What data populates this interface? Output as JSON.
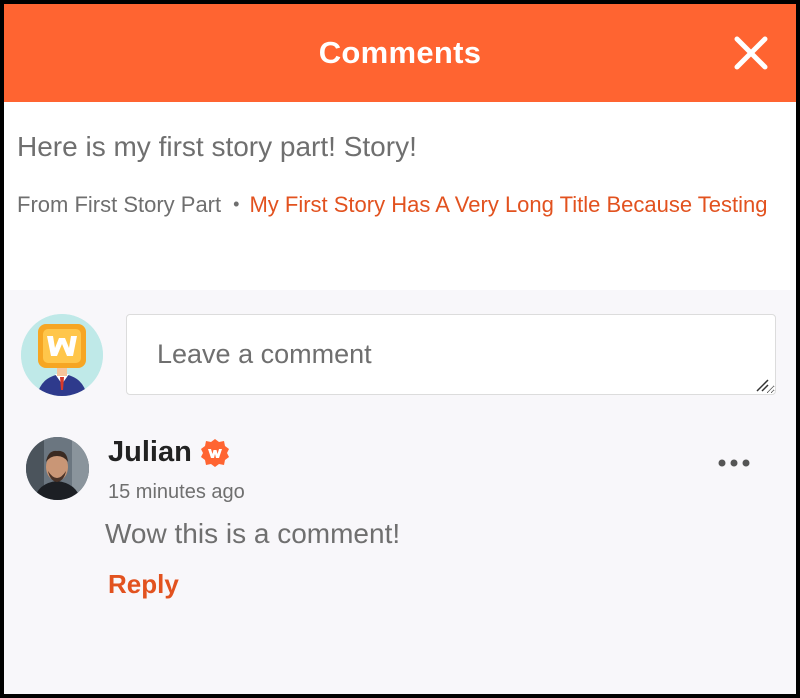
{
  "header": {
    "title": "Comments",
    "close_icon": "close-icon"
  },
  "story": {
    "text": "Here is my first story part! Story!",
    "from_label": "From First Story Part",
    "separator": "•",
    "story_title": "My First Story Has A Very Long Title Because Testing"
  },
  "composer": {
    "placeholder": "Leave a comment",
    "avatar_icon": "wattpad-avatar-icon"
  },
  "comments": [
    {
      "author": "Julian",
      "badge_icon": "verified-badge-icon",
      "time": "15 minutes ago",
      "body": "Wow this is a comment!",
      "reply_label": "Reply",
      "more_icon": "more-options-icon"
    }
  ],
  "colors": {
    "brand": "#ff6431",
    "link": "#e2521f",
    "text_muted": "#6f6f6f",
    "background": "#f8f7fa"
  }
}
